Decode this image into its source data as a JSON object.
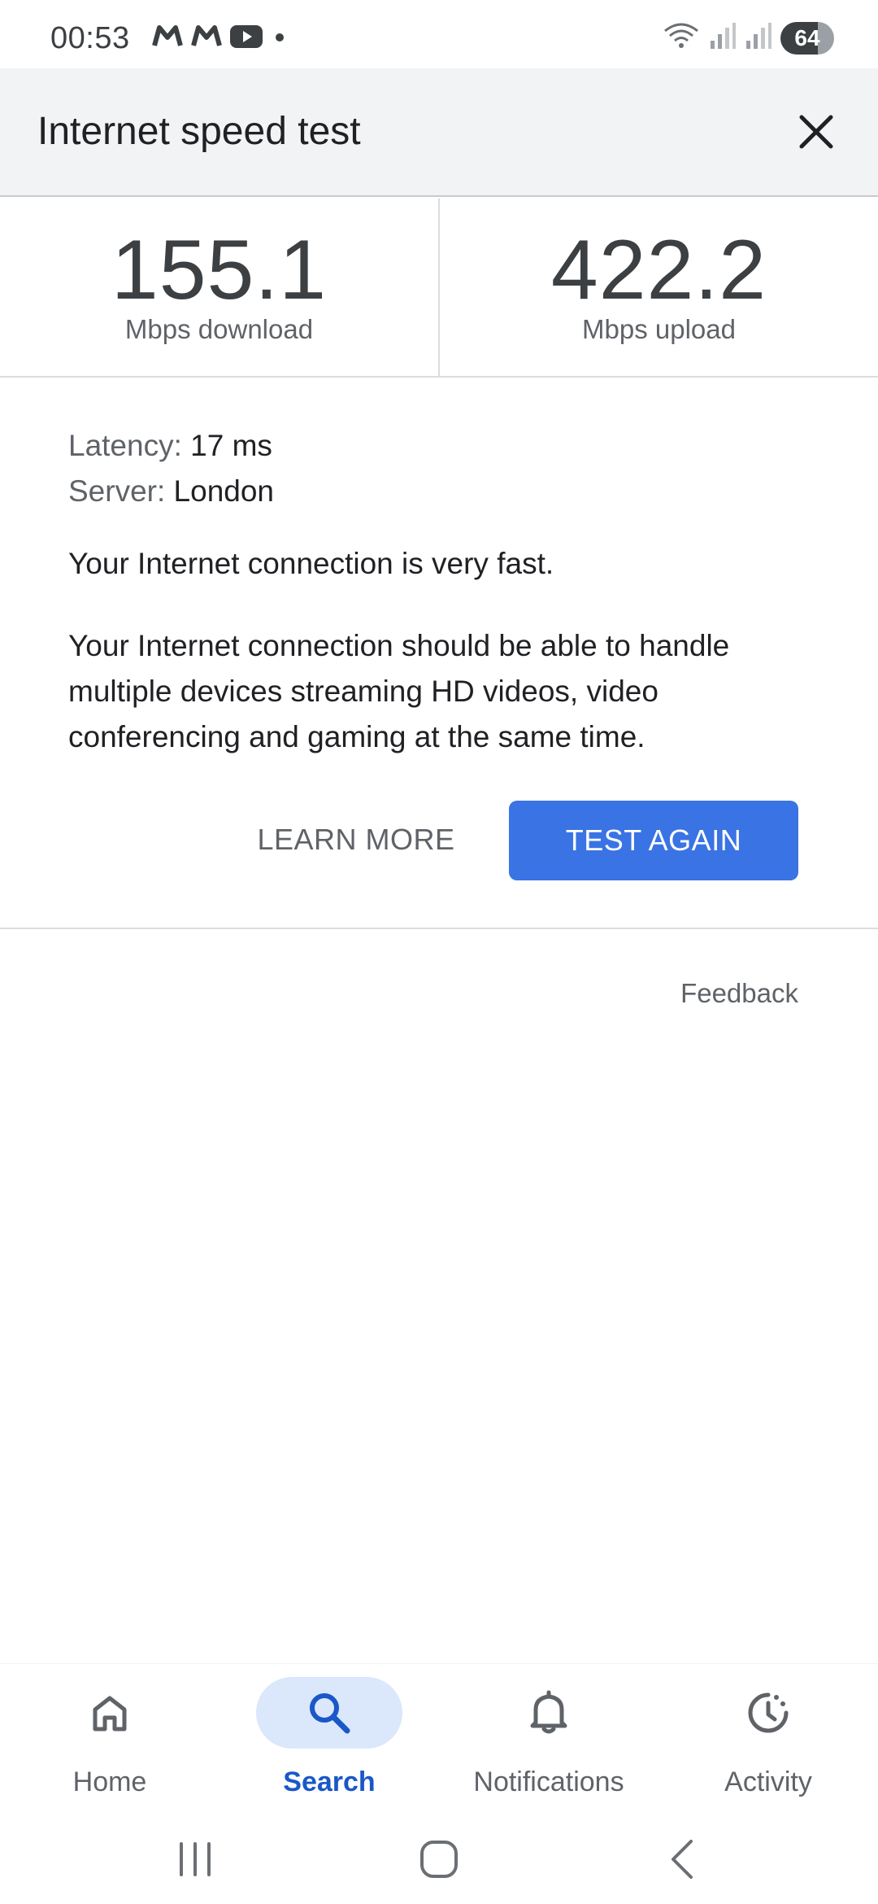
{
  "status_bar": {
    "time": "00:53",
    "battery": "64"
  },
  "header": {
    "title": "Internet speed test"
  },
  "results": {
    "download_value": "155.1",
    "download_label": "Mbps download",
    "upload_value": "422.2",
    "upload_label": "Mbps upload"
  },
  "details": {
    "latency_key": "Latency:",
    "latency_value": "17 ms",
    "server_key": "Server:",
    "server_value": "London"
  },
  "verdict": "Your Internet connection is very fast.",
  "explanation": "Your Internet connection should be able to handle multiple devices streaming HD videos, video conferencing and gaming at the same time.",
  "actions": {
    "learn_more": "LEARN MORE",
    "test_again": "TEST AGAIN"
  },
  "feedback": "Feedback",
  "bottom_nav": {
    "items": [
      {
        "label": "Home",
        "icon": "home-icon"
      },
      {
        "label": "Search",
        "icon": "search-icon",
        "active": true
      },
      {
        "label": "Notifications",
        "icon": "bell-icon"
      },
      {
        "label": "Activity",
        "icon": "activity-icon"
      }
    ]
  },
  "colors": {
    "accent": "#3a73e3",
    "active_nav": "#1a57c8",
    "header_bg": "#f1f3f4"
  }
}
